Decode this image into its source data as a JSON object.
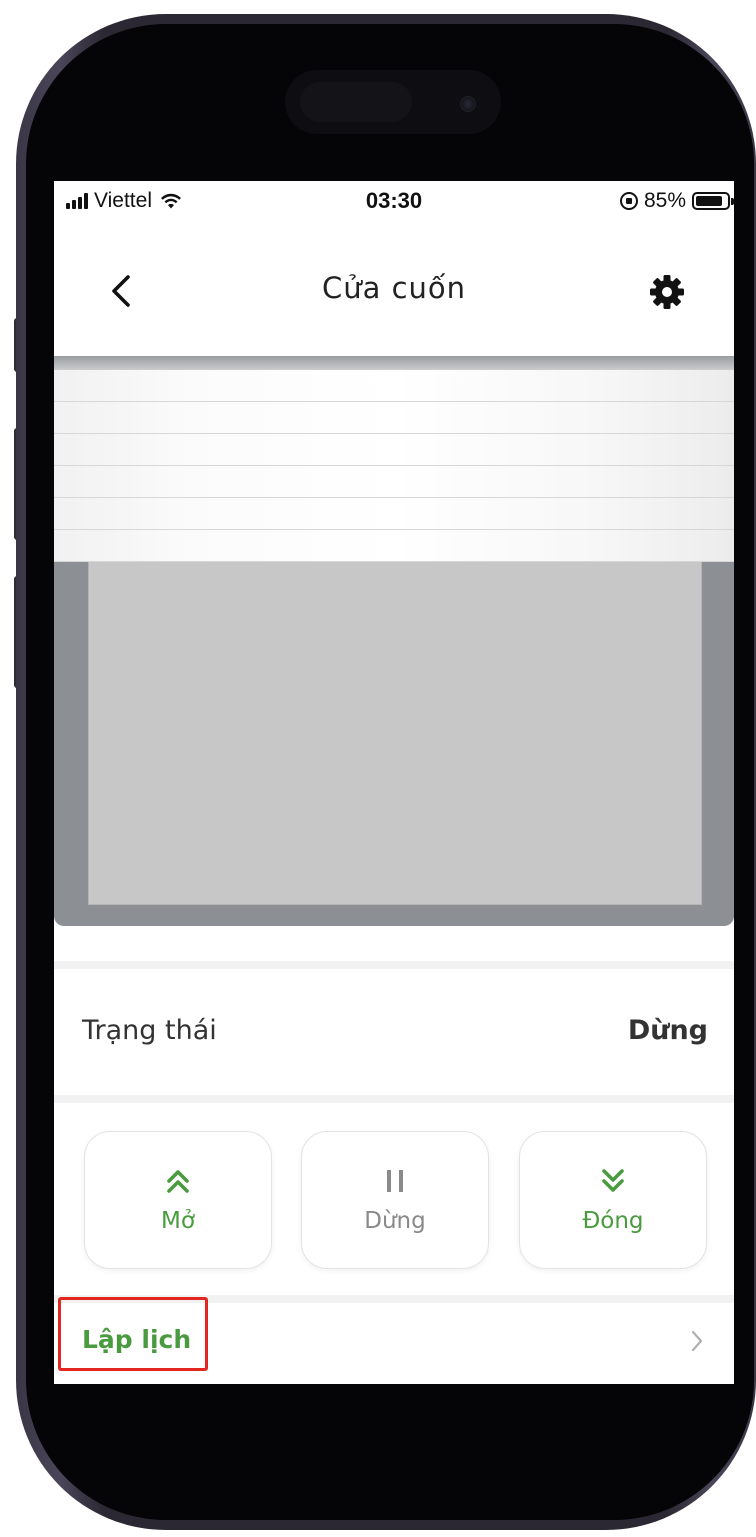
{
  "status_bar": {
    "carrier": "Viettel",
    "time": "03:30",
    "battery": "85%",
    "battery_level": 0.85,
    "icons": [
      "signal-icon",
      "wifi-icon",
      "rotation-lock-icon",
      "battery-icon"
    ]
  },
  "header": {
    "title": "Cửa cuốn",
    "back_icon": "chevron-left-icon",
    "settings_icon": "gear-icon"
  },
  "shutter": {
    "slat_count": 6,
    "colors": {
      "frame": "#8c8f93",
      "opening": "#c7c7c7",
      "slat": "#ffffff"
    }
  },
  "status": {
    "label": "Trạng thái",
    "value": "Dừng"
  },
  "controls": [
    {
      "label": "Mở",
      "icon": "double-chevron-up-icon",
      "color": "#4a9b3f"
    },
    {
      "label": "Dừng",
      "icon": "pause-icon",
      "color": "#8a8a8a"
    },
    {
      "label": "Đóng",
      "icon": "double-chevron-down-icon",
      "color": "#4a9b3f"
    }
  ],
  "schedule": {
    "label": "Lập lịch",
    "icon": "chevron-right-icon",
    "highlight_color": "#e3261f"
  },
  "colors": {
    "accent": "#4a9b3f",
    "divider": "#f2f2f2"
  }
}
